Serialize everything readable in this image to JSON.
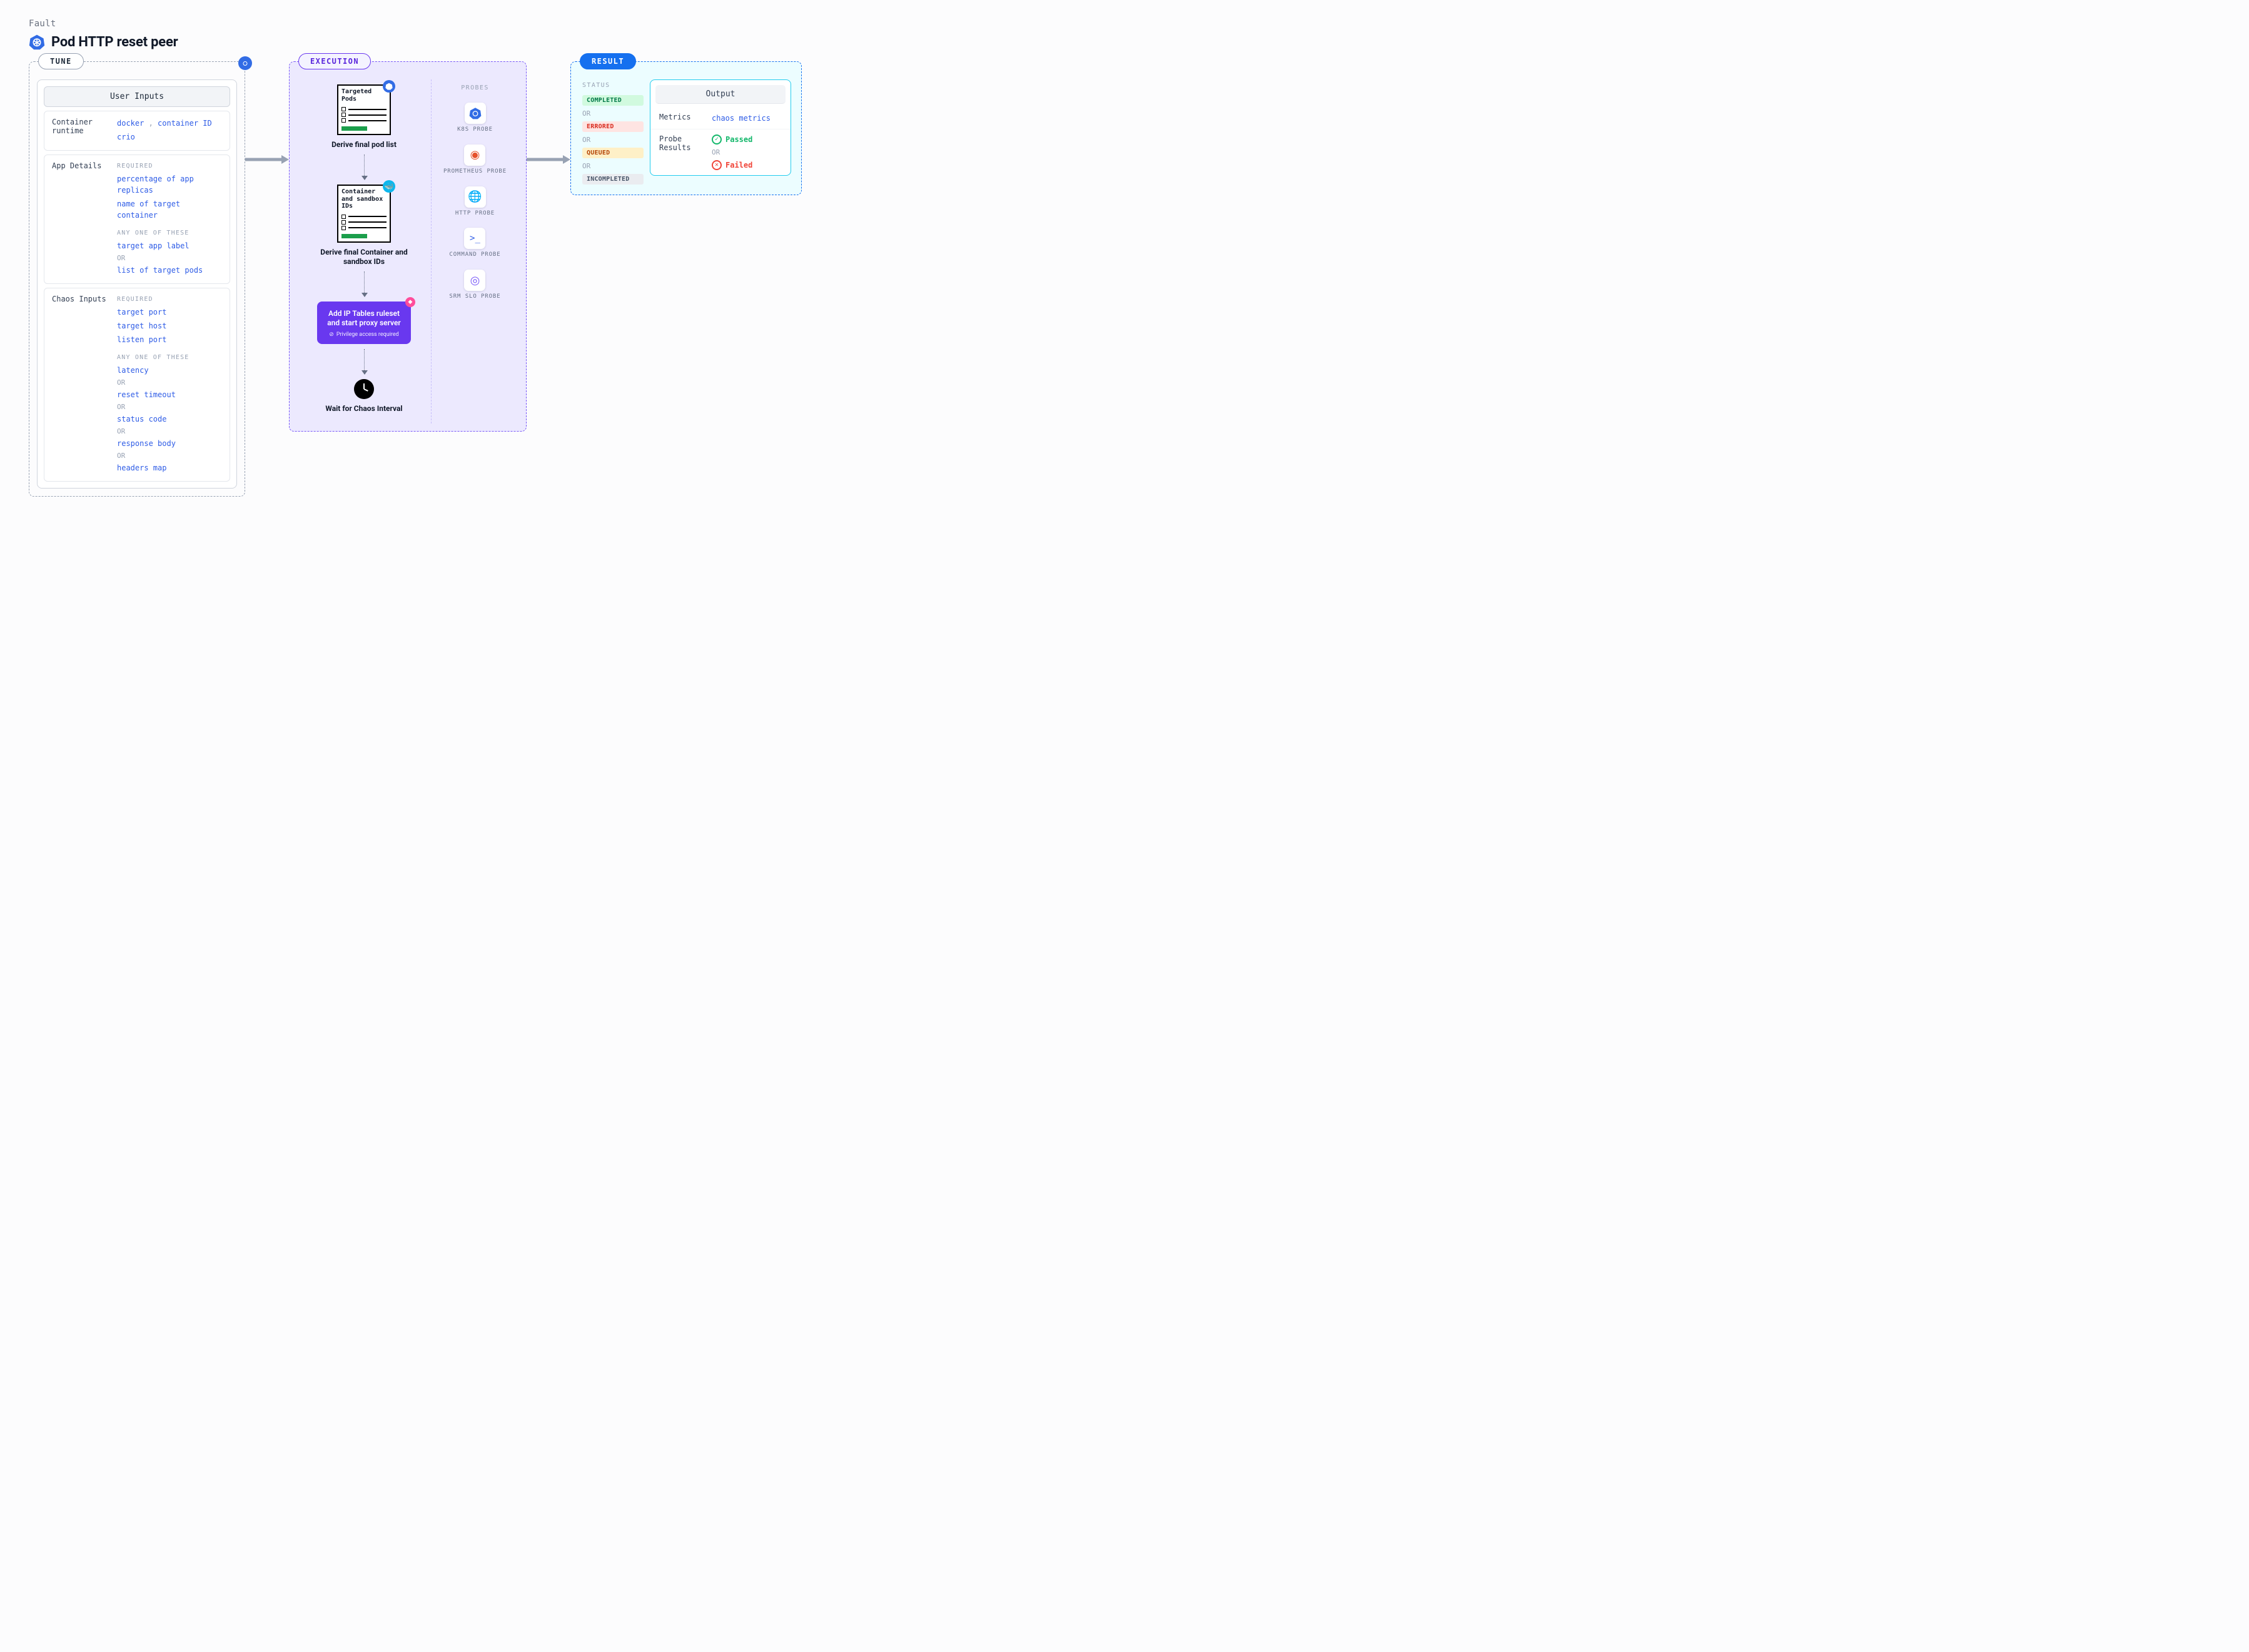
{
  "header": {
    "breadcrumb": "Fault",
    "title": "Pod HTTP reset peer"
  },
  "sections": {
    "tune_label": "TUNE",
    "exec_label": "EXECUTION",
    "result_label": "RESULT"
  },
  "tune": {
    "card_title": "User Inputs",
    "container": {
      "label": "Container runtime",
      "values": [
        "docker",
        "container ID",
        "crio"
      ]
    },
    "app_details": {
      "label": "App Details",
      "required_title": "REQUIRED",
      "required": [
        "percentage of app replicas",
        "name of target container"
      ],
      "any_title": "ANY ONE OF THESE",
      "any": [
        "target app label",
        "list of target pods"
      ]
    },
    "chaos_inputs": {
      "label": "Chaos Inputs",
      "required_title": "REQUIRED",
      "required": [
        "target port",
        "target host",
        "listen port"
      ],
      "any_title": "ANY ONE OF THESE",
      "any": [
        "latency",
        "reset timeout",
        "status code",
        "response body",
        "headers map"
      ]
    },
    "or": "OR"
  },
  "execution": {
    "probes_title": "PROBES",
    "step1_doc": "Targeted Pods",
    "step1_label": "Derive final pod list",
    "step2_doc": "Container and sandbox IDs",
    "step2_label": "Derive final Container and sandbox IDs",
    "action_title": "Add IP Tables ruleset and start proxy server",
    "action_sub": "Privilege access required",
    "wait_label": "Wait for Chaos Interval",
    "probes": [
      {
        "name": "K8S PROBE"
      },
      {
        "name": "PROMETHEUS PROBE"
      },
      {
        "name": "HTTP PROBE"
      },
      {
        "name": "COMMAND PROBE"
      },
      {
        "name": "SRM SLO PROBE"
      }
    ]
  },
  "result": {
    "status_title": "STATUS",
    "statuses": [
      "COMPLETED",
      "ERRORED",
      "QUEUED",
      "INCOMPLETED"
    ],
    "or": "OR",
    "output_title": "Output",
    "metrics_label": "Metrics",
    "metrics_value": "chaos metrics",
    "probe_results_label": "Probe Results",
    "passed": "Passed",
    "failed": "Failed"
  }
}
